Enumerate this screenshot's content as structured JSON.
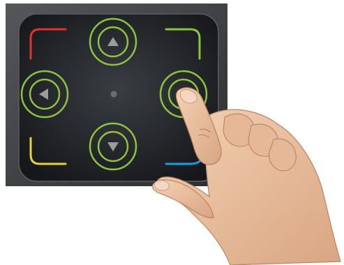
{
  "colors": {
    "remote_body": "#3a3b3d",
    "touchpad": "#1f2124",
    "button_ring": "#8bc53f",
    "arrow_fill": "#9a9da0",
    "center_dot": "#6b6e72",
    "corner_top_left": "#e0332f",
    "corner_top_right": "#8bc53f",
    "corner_bottom_left": "#e6d33a",
    "corner_bottom_right": "#1e9ae0",
    "skin": "#e8bf9c"
  },
  "dpad": {
    "buttons": [
      {
        "id": "up",
        "icon": "arrow-up-icon"
      },
      {
        "id": "down",
        "icon": "arrow-down-icon"
      },
      {
        "id": "left",
        "icon": "arrow-left-icon"
      },
      {
        "id": "right",
        "icon": "arrow-right-icon"
      }
    ],
    "pressed": "right"
  },
  "corner_keys": [
    "top-left-red",
    "top-right-green",
    "bottom-left-yellow",
    "bottom-right-blue"
  ]
}
